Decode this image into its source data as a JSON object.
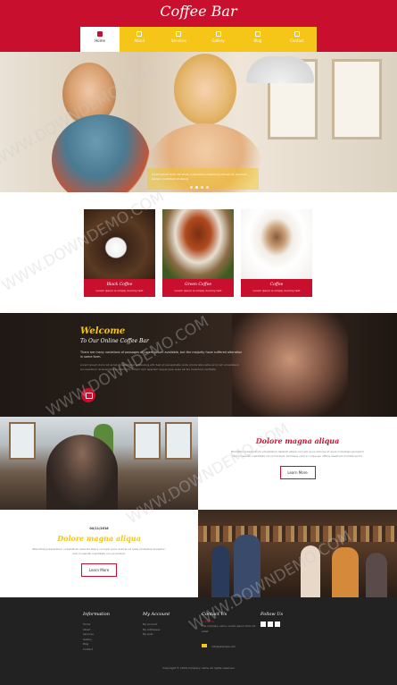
{
  "site": {
    "logo": "Coffee Bar"
  },
  "nav": {
    "items": [
      {
        "label": "Home",
        "active": true
      },
      {
        "label": "About"
      },
      {
        "label": "Services"
      },
      {
        "label": "Gallery"
      },
      {
        "label": "Blog"
      },
      {
        "label": "Contact"
      }
    ]
  },
  "hero": {
    "caption": "Lorem ipsum dolor sit amet consectetur adipiscing elit sed do eiusmod tempor incididunt ut labore",
    "slide_count": 4,
    "active_slide": 2
  },
  "products": [
    {
      "name": "Black Coffee",
      "sub": "Lorem Ipsum is simply dummy text"
    },
    {
      "name": "Green Coffee",
      "sub": "Lorem Ipsum is simply dummy text"
    },
    {
      "name": "Coffee",
      "sub": "Lorem Ipsum is simply dummy text"
    }
  ],
  "welcome": {
    "title": "Welcome",
    "subtitle": "To Our Online Coffee Bar",
    "text": "There are many variations of passages of Lorem Ipsum available, but the majority have suffered alteration in some form.",
    "text2": "Lorem ipsum dolor sit amet, consectetur adipiscing elit. Sed ut perspiciatis unde omnis iste natus error sit voluptatem accusantium doloremque laudantium, totam rem aperiam eaque ipsa quae ab illo inventore veritatis."
  },
  "block_right": {
    "title": "Dolore magna aliqua",
    "text": "Blanditiis praesentium voluptatum deleniti atque corrupti quos dolores et quas molestias excepturi sint occaecati cupiditate non provident, similique sunt in culpa qui officia deserunt mollitia animi.",
    "button": "Learn More"
  },
  "block_left": {
    "date": "04/11/2016",
    "title": "Dolore magna aliqua",
    "text": "Blanditiis praesentium voluptatum deleniti atque corrupti quos dolores et quas molestias excepturi sint occaecati cupiditate non provident.",
    "button": "Learn More"
  },
  "footer": {
    "information": {
      "title": "Information",
      "links": [
        "Home",
        "About",
        "Services",
        "Gallery",
        "Blog",
        "Contact"
      ]
    },
    "account": {
      "title": "My Account",
      "links": [
        "My Account",
        "My Addresses",
        "My Lists"
      ]
    },
    "contact": {
      "title": "Contact Us",
      "label": "Coffee bar",
      "address": "The company name, Lorem ipsum dolor sit amet",
      "email": "info@example.com"
    },
    "follow": {
      "title": "Follow Us"
    },
    "copyright": "Copyright © 2016 Company name All rights reserved"
  },
  "watermark": "WWW.DOWNDEMO.COM",
  "colors": {
    "brand_red": "#c8102e",
    "accent_yellow": "#f5c518",
    "footer_bg": "#222222"
  }
}
